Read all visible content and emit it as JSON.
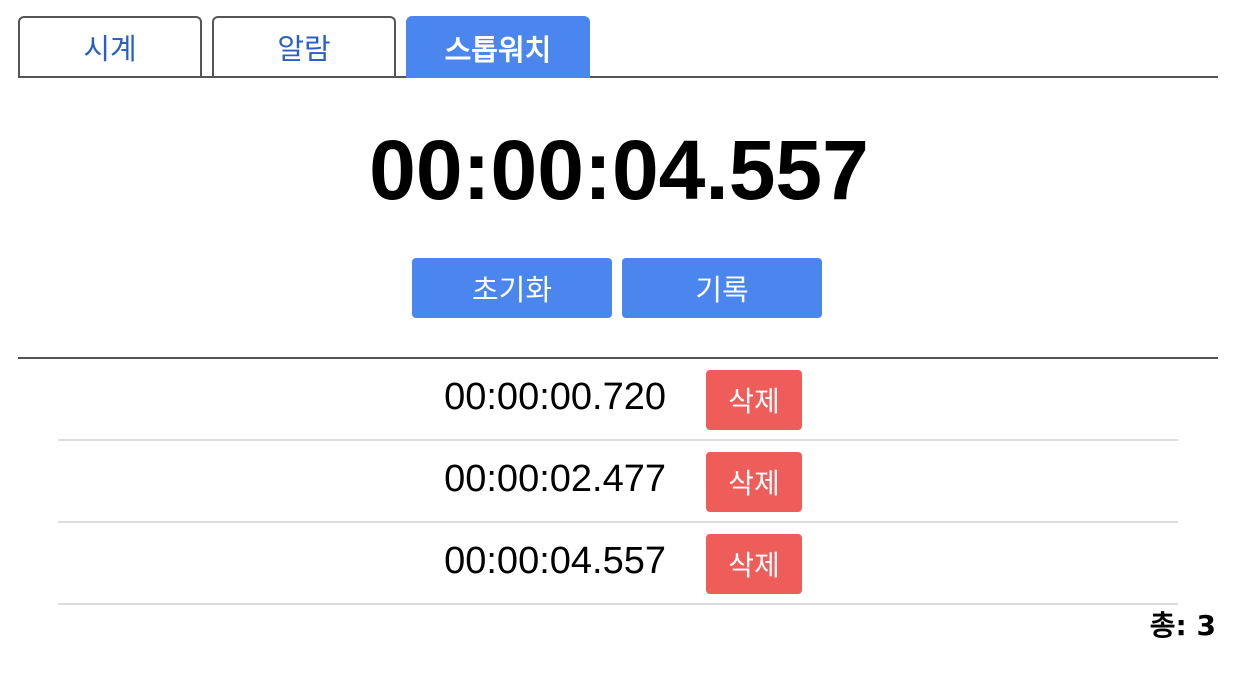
{
  "tabs": [
    {
      "label": "시계",
      "active": false
    },
    {
      "label": "알람",
      "active": false
    },
    {
      "label": "스톱워치",
      "active": true
    }
  ],
  "stopwatch": {
    "display": "00:00:04.557",
    "reset_label": "초기화",
    "lap_label": "기록"
  },
  "laps": [
    {
      "time": "00:00:00.720",
      "delete_label": "삭제"
    },
    {
      "time": "00:00:02.477",
      "delete_label": "삭제"
    },
    {
      "time": "00:00:04.557",
      "delete_label": "삭제"
    }
  ],
  "total": {
    "label": "총:",
    "count": "3"
  },
  "colors": {
    "accent": "#4a86ee",
    "tab_text": "#2a5fc4",
    "delete": "#ee5d5a",
    "border": "#555555"
  }
}
